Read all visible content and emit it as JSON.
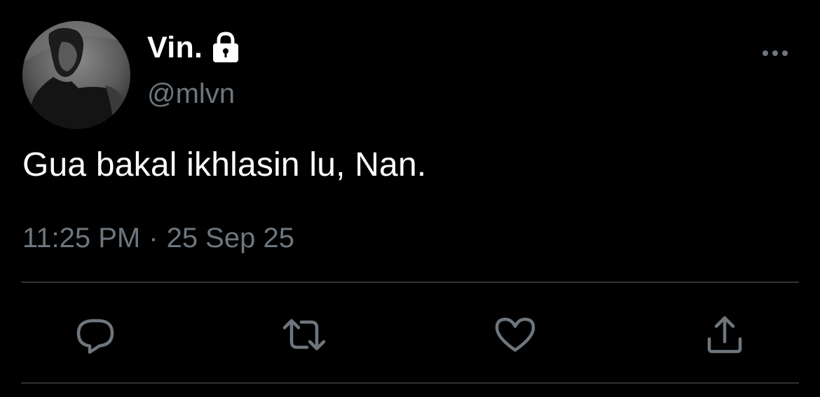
{
  "tweet": {
    "author": {
      "display_name": "Vin.",
      "handle": "@mlvn",
      "protected_icon": "lock-icon",
      "avatar_icon": "avatar-photo"
    },
    "text": "Gua bakal ikhlasin lu, Nan.",
    "time": "11:25 PM",
    "separator": "·",
    "date": "25 Sep 25",
    "more_icon": "more-options-icon"
  },
  "actions": [
    {
      "name": "reply",
      "icon": "reply-icon"
    },
    {
      "name": "retweet",
      "icon": "retweet-icon"
    },
    {
      "name": "like",
      "icon": "heart-icon"
    },
    {
      "name": "share",
      "icon": "share-icon"
    }
  ],
  "colors": {
    "background": "#000000",
    "primary_text": "#ffffff",
    "secondary_text": "#6e767d",
    "divider": "#2f3336"
  }
}
